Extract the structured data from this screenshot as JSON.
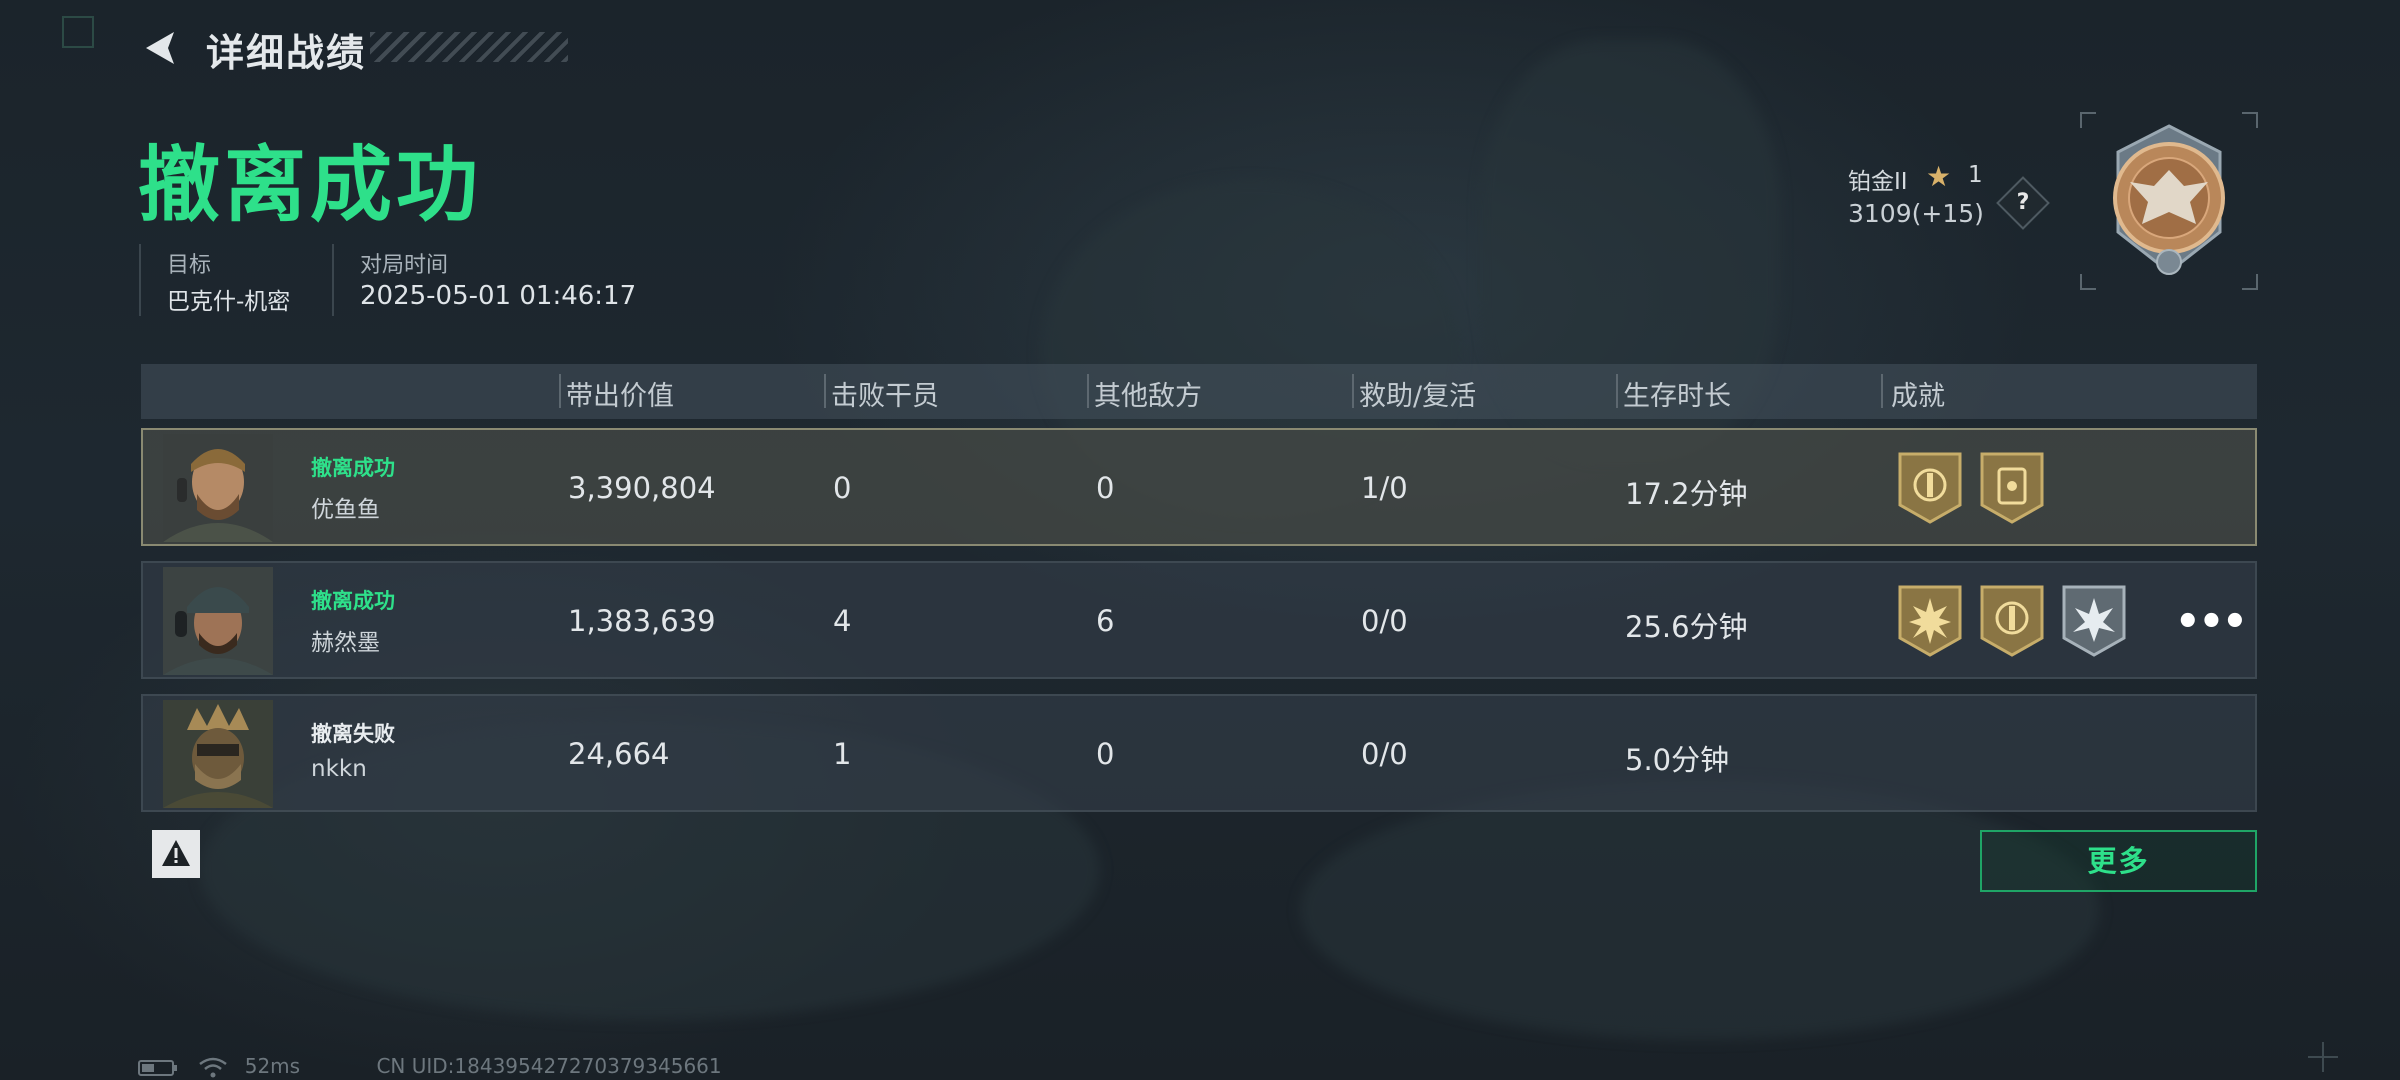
{
  "header": {
    "title": "详细战绩",
    "back_icon": "back-arrow-icon"
  },
  "result": {
    "title": "撤离成功",
    "color": "#2ee08a"
  },
  "meta": {
    "target_label": "目标",
    "target_value": "巴克什-机密",
    "time_label": "对局时间",
    "time_value": "2025-05-01 01:46:17"
  },
  "rank": {
    "tier": "铂金II",
    "stars": "1",
    "score": "3109(+15)",
    "help_label": "?",
    "badge_icon": "eagle-rank-medal-icon"
  },
  "table": {
    "columns": [
      "带出价值",
      "击败干员",
      "其他敌方",
      "救助/复活",
      "生存时长",
      "成就"
    ],
    "rows": [
      {
        "status": "撤离成功",
        "status_color": "#2ee08a",
        "name": "优鱼鱼",
        "value": "3,390,804",
        "kills": "0",
        "other": "0",
        "assist": "1/0",
        "survival": "17.2分钟",
        "badges": [
          "gold-shield-badge-icon",
          "gold-card-badge-icon"
        ]
      },
      {
        "status": "撤离成功",
        "status_color": "#2ee08a",
        "name": "赫然墨",
        "value": "1,383,639",
        "kills": "4",
        "other": "6",
        "assist": "0/0",
        "survival": "25.6分钟",
        "badges": [
          "gold-sun-badge-icon",
          "gold-shield-badge-icon",
          "silver-burst-badge-icon"
        ],
        "more": "•••"
      },
      {
        "status": "撤离失败",
        "status_color": "#e8ecef",
        "name": "nkkn",
        "value": "24,664",
        "kills": "1",
        "other": "0",
        "assist": "0/0",
        "survival": "5.0分钟",
        "badges": []
      }
    ]
  },
  "buttons": {
    "more_label": "更多",
    "warn_icon": "warning-icon"
  },
  "status_bar": {
    "ping": "52ms",
    "uid": "CN UID:1843954272703793456​61"
  }
}
